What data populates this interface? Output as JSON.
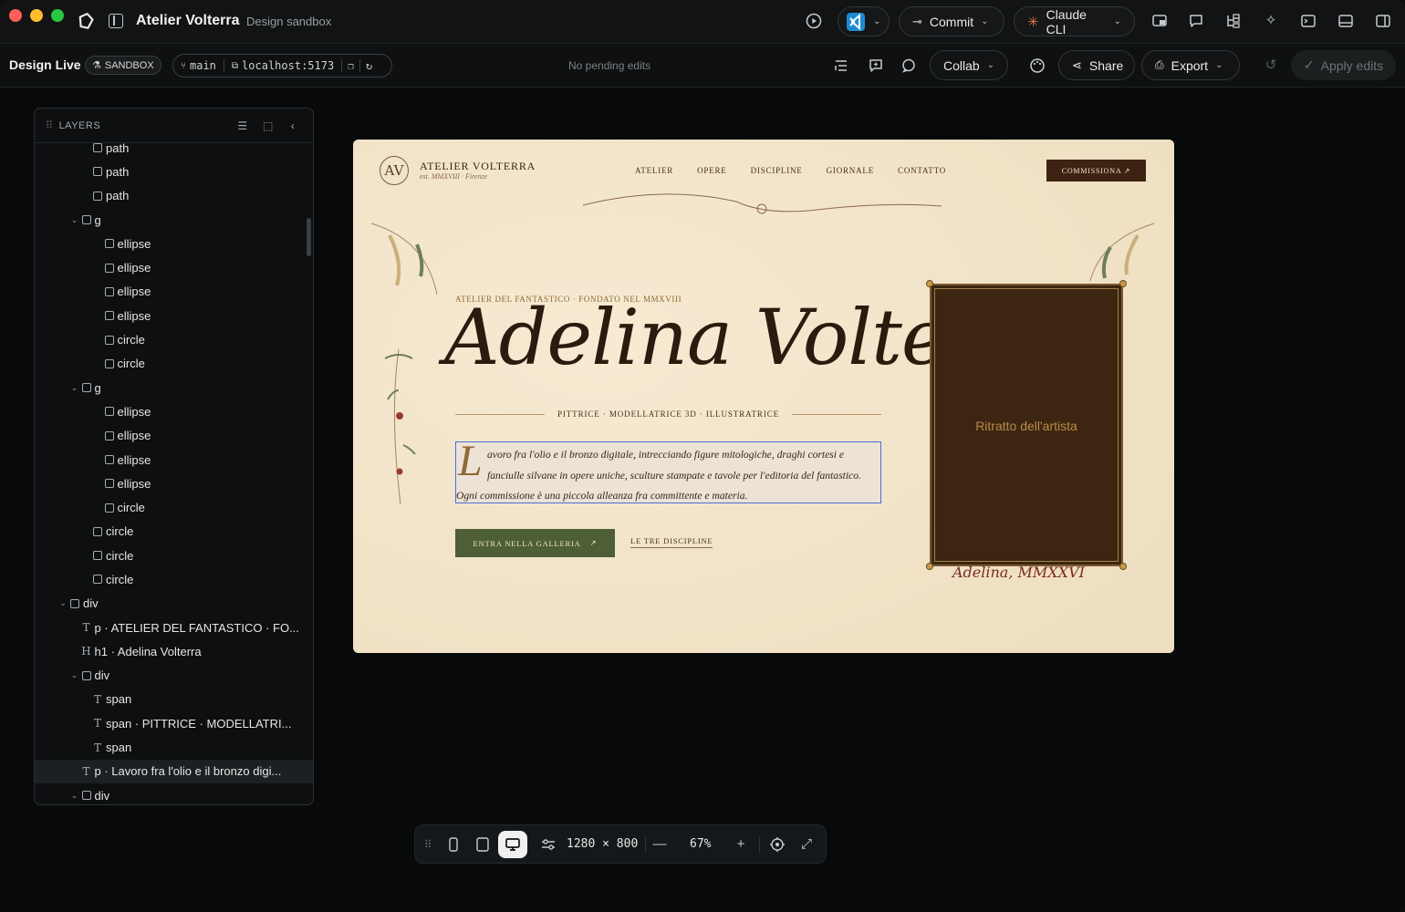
{
  "titlebar": {
    "app_title": "Atelier Volterra",
    "app_subtitle": "Design sandbox",
    "commit_label": "Commit",
    "claude_label": "Claude CLI"
  },
  "toolbar": {
    "mode_label": "Design Live",
    "sandbox_badge": "SANDBOX",
    "branch": "main",
    "url": "localhost:5173",
    "pending": "No pending edits",
    "collab_label": "Collab",
    "share_label": "Share",
    "export_label": "Export",
    "apply_label": "Apply edits"
  },
  "layers": {
    "title": "LAYERS",
    "rows": [
      {
        "label": "path",
        "glyph": "box",
        "depth": 4,
        "tw": ""
      },
      {
        "label": "path",
        "glyph": "box",
        "depth": 4,
        "tw": ""
      },
      {
        "label": "path",
        "glyph": "box",
        "depth": 4,
        "tw": ""
      },
      {
        "label": "g",
        "glyph": "box",
        "depth": 3,
        "tw": "v"
      },
      {
        "label": "ellipse",
        "glyph": "box",
        "depth": 5,
        "tw": ""
      },
      {
        "label": "ellipse",
        "glyph": "box",
        "depth": 5,
        "tw": ""
      },
      {
        "label": "ellipse",
        "glyph": "box",
        "depth": 5,
        "tw": ""
      },
      {
        "label": "ellipse",
        "glyph": "box",
        "depth": 5,
        "tw": ""
      },
      {
        "label": "circle",
        "glyph": "box",
        "depth": 5,
        "tw": ""
      },
      {
        "label": "circle",
        "glyph": "box",
        "depth": 5,
        "tw": ""
      },
      {
        "label": "g",
        "glyph": "box",
        "depth": 3,
        "tw": "v"
      },
      {
        "label": "ellipse",
        "glyph": "box",
        "depth": 5,
        "tw": ""
      },
      {
        "label": "ellipse",
        "glyph": "box",
        "depth": 5,
        "tw": ""
      },
      {
        "label": "ellipse",
        "glyph": "box",
        "depth": 5,
        "tw": ""
      },
      {
        "label": "ellipse",
        "glyph": "box",
        "depth": 5,
        "tw": ""
      },
      {
        "label": "circle",
        "glyph": "box",
        "depth": 5,
        "tw": ""
      },
      {
        "label": "circle",
        "glyph": "box",
        "depth": 4,
        "tw": ""
      },
      {
        "label": "circle",
        "glyph": "box",
        "depth": 4,
        "tw": ""
      },
      {
        "label": "circle",
        "glyph": "box",
        "depth": 4,
        "tw": ""
      },
      {
        "label": "div",
        "glyph": "box",
        "depth": 2,
        "tw": "v"
      },
      {
        "label": "p · ATELIER DEL FANTASTICO · FO...",
        "glyph": "T",
        "depth": 3,
        "tw": ""
      },
      {
        "label": "h1 · Adelina Volterra",
        "glyph": "H",
        "depth": 3,
        "tw": ""
      },
      {
        "label": "div",
        "glyph": "box",
        "depth": 3,
        "tw": "v"
      },
      {
        "label": "span",
        "glyph": "T",
        "depth": 4,
        "tw": ""
      },
      {
        "label": "span · PITTRICE · MODELLATRI...",
        "glyph": "T",
        "depth": 4,
        "tw": ""
      },
      {
        "label": "span",
        "glyph": "T",
        "depth": 4,
        "tw": ""
      },
      {
        "label": "p · Lavoro fra l'olio e il bronzo digi...",
        "glyph": "T",
        "depth": 3,
        "tw": "",
        "selected": true
      },
      {
        "label": "div",
        "glyph": "box",
        "depth": 3,
        "tw": "v"
      }
    ]
  },
  "site": {
    "brand": "ATELIER VOLTERRA",
    "est": "est. MMXVIII · Firenze",
    "logo": "AV",
    "nav": [
      "ATELIER",
      "OPERE",
      "DISCIPLINE",
      "GIORNALE",
      "CONTATTO"
    ],
    "commission": "COMMISSIONA ↗",
    "eyebrow": "ATELIER DEL FANTASTICO · FONDATO NEL MMXVIII",
    "h1": "Adelina Volterra",
    "role": "PITTRICE · MODELLATRICE 3D · ILLUSTRATRICE",
    "dropcap": "L",
    "para_1": "avoro fra l'olio e il bronzo digitale, intrecciando figure mitologiche, draghi cortesi e",
    "para_2": "fanciulle silvane in opere uniche, sculture stampate e tavole per l'editoria del fantastico.",
    "para_3": "Ogni commissione è una piccola alleanza fra committente e materia.",
    "cta": "ENTRA NELLA GALLERIA",
    "cta_arrow": "↗",
    "link": "LE TRE DISCIPLINE",
    "portrait_label": "Ritratto dell'artista",
    "signature": "Adelina, MMXXVI"
  },
  "dock": {
    "dims": "1280 × 800",
    "zoom": "67%"
  }
}
